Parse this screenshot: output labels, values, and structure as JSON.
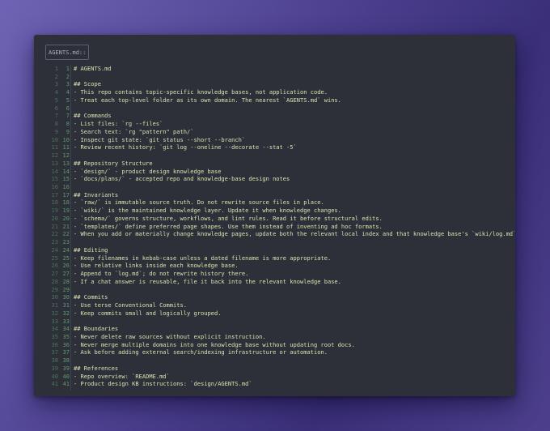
{
  "tab": {
    "title": "AGENTS.md::"
  },
  "editor": {
    "lines": [
      "# AGENTS.md",
      "",
      "## Scope",
      "- This repo contains topic-specific knowledge bases, not application code.",
      "- Treat each top-level folder as its own domain. The nearest `AGENTS.md` wins.",
      "",
      "## Commands",
      "- List files: `rg --files`",
      "- Search text: `rg \"pattern\" path/`",
      "- Inspect git state: `git status --short --branch`",
      "- Review recent history: `git log --oneline --decorate --stat -5`",
      "",
      "## Repository Structure",
      "- `design/` - product design knowledge base",
      "- `docs/plans/` - accepted repo and knowledge-base design notes",
      "",
      "## Invariants",
      "- `raw/` is immutable source truth. Do not rewrite source files in place.",
      "- `wiki/` is the maintained knowledge layer. Update it when knowledge changes.",
      "- `schema/` governs structure, workflows, and lint rules. Read it before structural edits.",
      "- `templates/` define preferred page shapes. Use them instead of inventing ad hoc formats.",
      "- When you add or materially change knowledge pages, update both the relevant local index and that knowledge base's `wiki/log.md`.",
      "",
      "## Editing",
      "- Keep filenames in kebab-case unless a dated filename is more appropriate.",
      "- Use relative links inside each knowledge base.",
      "- Append to `log.md`; do not rewrite history there.",
      "- If a chat answer is reusable, file it back into the relevant knowledge base.",
      "",
      "## Commits",
      "- Use terse Conventional Commits.",
      "- Keep commits small and logically grouped.",
      "",
      "## Boundaries",
      "- Never delete raw sources without explicit instruction.",
      "- Never merge multiple domains into one knowledge base without updating root docs.",
      "- Ask before adding external search/indexing infrastructure or automation.",
      "",
      "## References",
      "- Repo overview: `README.md`",
      "- Product design KB instructions: `design/AGENTS.md`"
    ]
  }
}
